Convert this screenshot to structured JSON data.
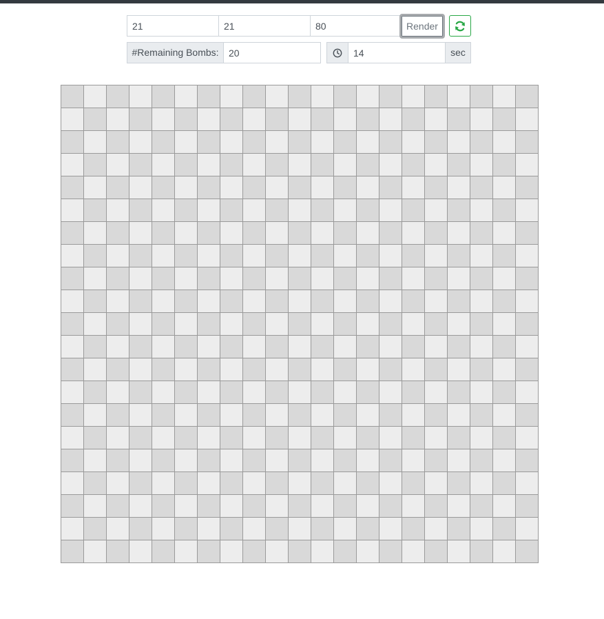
{
  "controls": {
    "rows_value": "21",
    "cols_value": "21",
    "bombs_value": "80",
    "render_label": "Render",
    "refresh_icon": "refresh-icon"
  },
  "status": {
    "remaining_bombs_label": "#Remaining Bombs:",
    "remaining_bombs_value": "20",
    "timer_icon": "clock-icon",
    "timer_value": "14",
    "timer_unit": "sec"
  },
  "board": {
    "rows": 21,
    "cols": 21,
    "cell_state": "unrevealed",
    "colors": {
      "dark": "#d9d9d9",
      "light": "#ededed",
      "grid": "#9a9a9a"
    }
  },
  "colors": {
    "topbar": "#343a40",
    "refresh_accent": "#28a745"
  }
}
